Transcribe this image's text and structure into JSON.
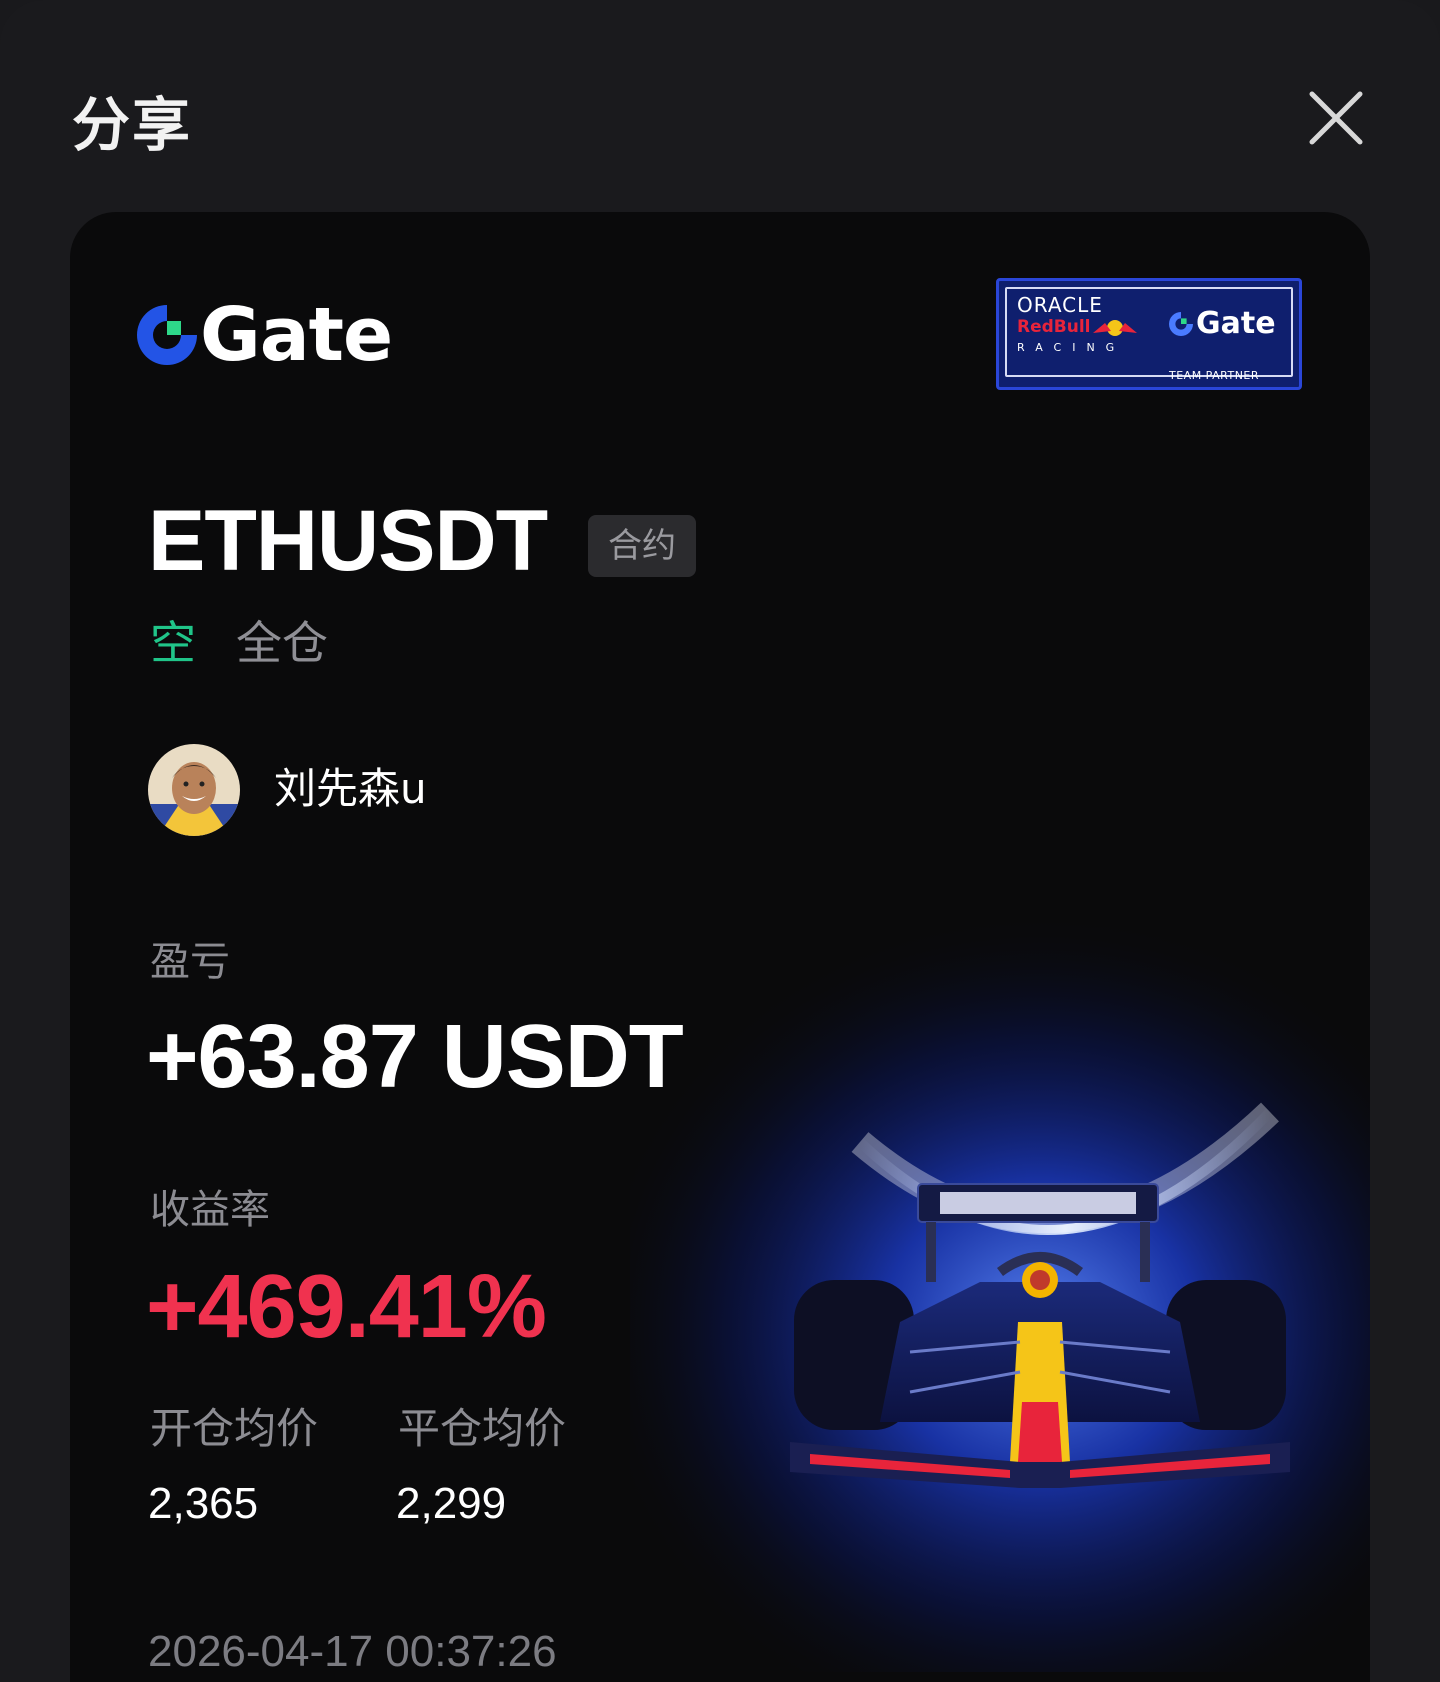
{
  "sheet": {
    "title": "分享",
    "close_icon": "close-icon"
  },
  "card": {
    "brand": {
      "name": "Gate",
      "logo_icon": "gate-logo-icon"
    },
    "partner_badge": {
      "line1": "ORACLE",
      "line2": "RedBull",
      "line3": "RACING",
      "brand": "Gate",
      "caption": "TEAM PARTNER"
    },
    "symbol": "ETHUSDT",
    "contract_tag": "合约",
    "side": "空",
    "margin_mode": "全仓",
    "user": {
      "name": "刘先森u",
      "avatar_icon": "avatar-image"
    },
    "pnl": {
      "label": "盈亏",
      "value": "+63.87 USDT"
    },
    "roi": {
      "label": "收益率",
      "value": "+469.41%"
    },
    "entry_price": {
      "label": "开仓均价",
      "value": "2,365"
    },
    "exit_price": {
      "label": "平仓均价",
      "value": "2,299"
    },
    "timestamp": "2026-04-17 00:37:26",
    "colors": {
      "short": "#20c589",
      "roi_positive": "#f0324f",
      "brand_blue": "#2354e6",
      "brand_green": "#2ed889"
    }
  }
}
